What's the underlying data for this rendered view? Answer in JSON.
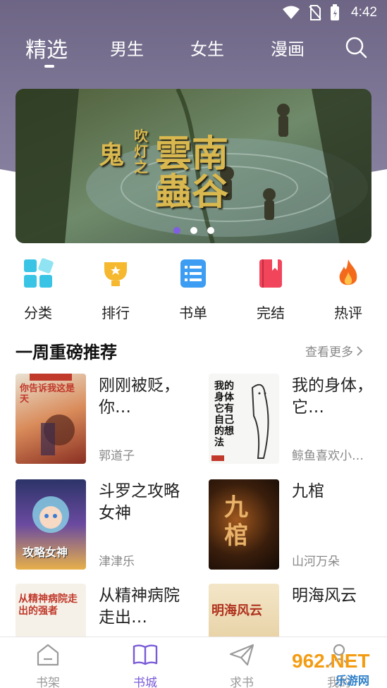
{
  "status": {
    "time": "4:42"
  },
  "tabs": [
    {
      "label": "精选",
      "active": true
    },
    {
      "label": "男生",
      "active": false
    },
    {
      "label": "女生",
      "active": false
    },
    {
      "label": "漫画",
      "active": false
    }
  ],
  "banner": {
    "title_main": "鬼",
    "title_small": "吹灯之",
    "title_big": "雲南蟲谷",
    "slides": 3,
    "active_slide": 1
  },
  "categories": [
    {
      "label": "分类",
      "icon": "grid-icon"
    },
    {
      "label": "排行",
      "icon": "trophy-icon"
    },
    {
      "label": "书单",
      "icon": "list-icon"
    },
    {
      "label": "完结",
      "icon": "bookmark-book-icon"
    },
    {
      "label": "热评",
      "icon": "flame-icon"
    }
  ],
  "section": {
    "title": "一周重磅推荐",
    "more": "查看更多"
  },
  "books": [
    {
      "title": "刚刚被贬，你…",
      "author": "郭道子",
      "cover_text": "你告诉我这是天",
      "cover_color": "#c8483a"
    },
    {
      "title": "我的身体，它…",
      "author": "鲸鱼喜欢小…",
      "cover_text": "我的身体它有自己的想法",
      "cover_color": "#f2f2f2"
    },
    {
      "title": "斗罗之攻略女神",
      "author": "津津乐",
      "cover_text": "攻略女神",
      "cover_color": "#3b3f8f"
    },
    {
      "title": "九棺",
      "author": "山河万朵",
      "cover_text": "九棺",
      "cover_color": "#2a1a10"
    },
    {
      "title": "从精神病院走出…",
      "author": "",
      "cover_text": "从精神病院走出的强者",
      "cover_color": "#f4efe6"
    },
    {
      "title": "明海风云",
      "author": "",
      "cover_text": "明海风云",
      "cover_color": "#e9d7b4"
    }
  ],
  "bottom_nav": [
    {
      "label": "书架",
      "icon": "home-shelf-icon",
      "active": false
    },
    {
      "label": "书城",
      "icon": "open-book-icon",
      "active": true
    },
    {
      "label": "求书",
      "icon": "paper-plane-icon",
      "active": false
    },
    {
      "label": "我的",
      "icon": "user-icon",
      "active": false
    }
  ],
  "watermark": {
    "text": "962.NET",
    "sub": "乐游网"
  },
  "colors": {
    "accent": "#7a5bd6",
    "header": "#7f7897"
  }
}
